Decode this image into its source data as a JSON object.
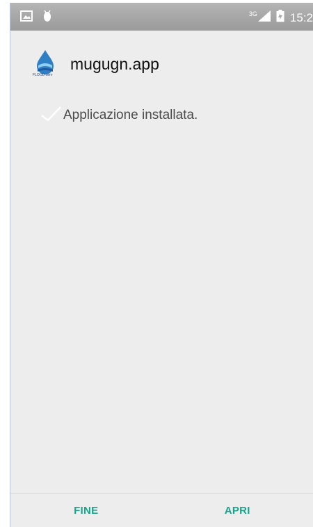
{
  "status_bar": {
    "left_icons": [
      "image-notification-icon",
      "android-debug-icon"
    ],
    "network": "3G",
    "time": "15:2"
  },
  "app": {
    "name": "mugugn.app",
    "icon_text": "FLOOD-serv"
  },
  "install": {
    "message": "Applicazione installata."
  },
  "buttons": {
    "done": "FINE",
    "open": "APRI"
  },
  "colors": {
    "accent": "#17a48b",
    "background": "#ededed",
    "status_bar": "#a8a8a8"
  }
}
